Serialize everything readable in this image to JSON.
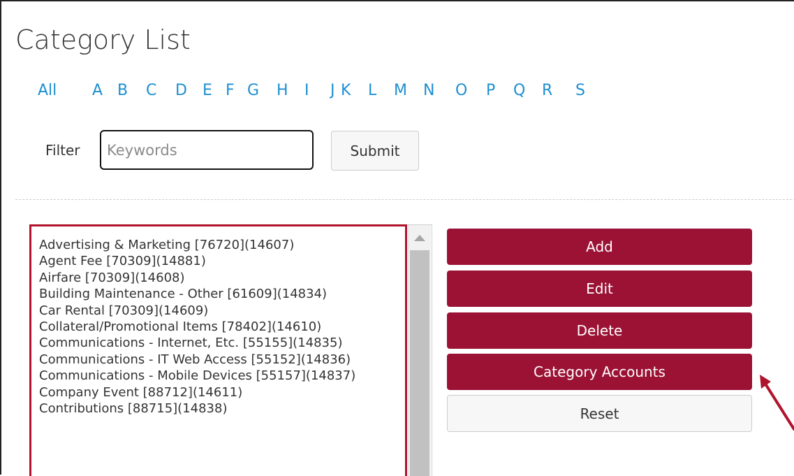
{
  "page": {
    "title": "Category List"
  },
  "alphabet": [
    "All",
    "A",
    "B",
    "C",
    "D",
    "E",
    "F",
    "G",
    "H",
    "I",
    "J",
    "K",
    "L",
    "M",
    "N",
    "O",
    "P",
    "Q",
    "R",
    "S"
  ],
  "filter": {
    "label": "Filter",
    "placeholder": "Keywords",
    "value": "",
    "submit_label": "Submit"
  },
  "categories": [
    "Advertising & Marketing [76720](14607)",
    "Agent Fee [70309](14881)",
    "Airfare [70309](14608)",
    "Building Maintenance - Other [61609](14834)",
    "Car Rental [70309](14609)",
    "Collateral/Promotional Items [78402](14610)",
    "Communications - Internet, Etc. [55155](14835)",
    "Communications - IT Web Access [55152](14836)",
    "Communications - Mobile Devices [55157](14837)",
    "Company Event [88712](14611)",
    "Contributions [88715](14838)"
  ],
  "actions": {
    "add": "Add",
    "edit": "Edit",
    "delete": "Delete",
    "category_accounts": "Category Accounts",
    "reset": "Reset"
  },
  "colors": {
    "accent": "#9b1235",
    "link": "#1f8fd1",
    "highlight": "#b0142d"
  }
}
